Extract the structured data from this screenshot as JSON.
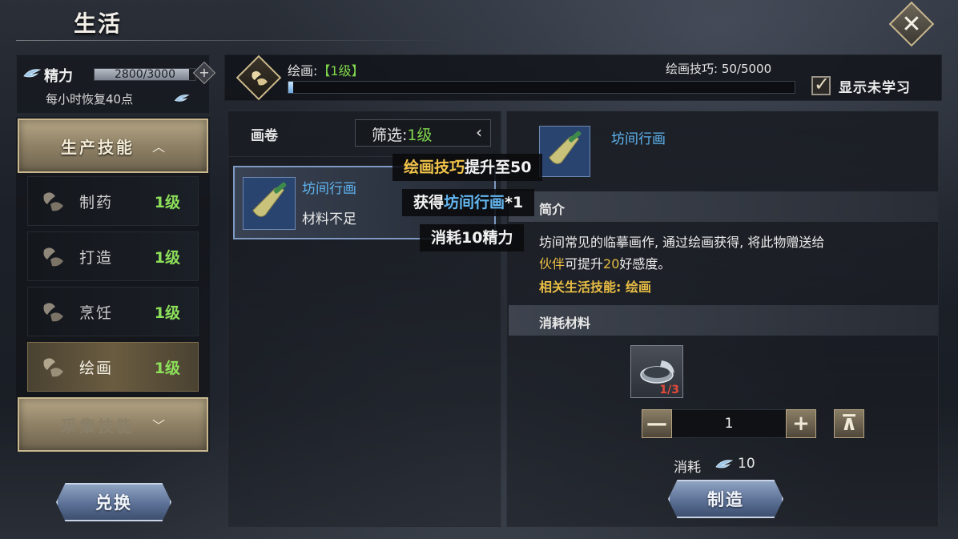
{
  "header": {
    "title": "生活",
    "close_icon": "close-icon"
  },
  "stamina": {
    "label": "精力",
    "value_text": "2800/3000",
    "fraction": 0.9333,
    "recover_text": "每小时恢复40点",
    "icon": "feather-icon"
  },
  "categories": [
    {
      "label": "生产技能",
      "chevron": "︿",
      "expanded": true
    },
    {
      "label": "采集技能",
      "chevron": "﹀",
      "expanded": false
    }
  ],
  "skills": [
    {
      "name": "制药",
      "level": "1级",
      "active": false
    },
    {
      "name": "打造",
      "level": "1级",
      "active": false
    },
    {
      "name": "烹饪",
      "level": "1级",
      "active": false
    },
    {
      "name": "绘画",
      "level": "1级",
      "active": true
    }
  ],
  "buttons": {
    "exchange": "兑换",
    "craft": "制造"
  },
  "skill_header": {
    "name": "绘画:",
    "level": "【1级】",
    "skill_text": "绘画技巧: 50/5000",
    "progress_fraction": 0.01,
    "show_unlearned": "显示未学习",
    "show_unlearned_checked": true
  },
  "list": {
    "title": "画卷",
    "filter_label": "筛选:",
    "filter_value": "1级",
    "filter_arrow": "‹",
    "items": [
      {
        "name": "坊间行画",
        "status": "材料不足"
      }
    ]
  },
  "tooltip": {
    "line1_a": "绘画技巧",
    "line1_b": "提升至50",
    "line2_a": "获得",
    "line2_b": "坊间行画",
    "line2_c": "*1",
    "line3": "消耗10精力"
  },
  "detail": {
    "name": "坊间行画",
    "intro_header": "简介",
    "desc_a": "坊间常见的临摹画作, 通过绘画获得, 将此物赠送给",
    "desc_b": "伙伴",
    "desc_c": "可提升",
    "desc_d": "20",
    "desc_e": "好感度。",
    "related": "相关生活技能: 绘画",
    "materials_header": "消耗材料",
    "material_count": "1/3",
    "quantity": "1",
    "minus": "—",
    "plus": "+",
    "max": "⊼",
    "cost_label": "消耗",
    "cost_value": "10"
  },
  "colors": {
    "level_green": "#7fd64c",
    "item_blue": "#5fb3ef",
    "gold": "#e8bd45",
    "warn_red": "#e24a3a"
  }
}
